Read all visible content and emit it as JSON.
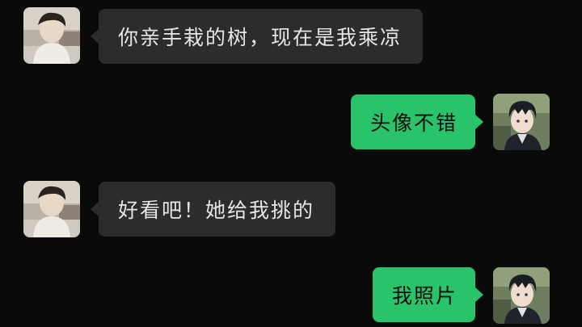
{
  "messages": [
    {
      "side": "in",
      "avatar": "contact-avatar",
      "text": "你亲手栽的树，现在是我乘凉"
    },
    {
      "side": "out",
      "avatar": "self-avatar",
      "text": "头像不错"
    },
    {
      "side": "in",
      "avatar": "contact-avatar",
      "text": "好看吧！她给我挑的"
    },
    {
      "side": "out",
      "avatar": "self-avatar",
      "text": "我照片"
    }
  ],
  "colors": {
    "background": "#0a0a0a",
    "incoming_bubble": "#2c2c2c",
    "incoming_text": "#e6e6e6",
    "outgoing_bubble": "#29c369",
    "outgoing_text": "#0d0d0d"
  }
}
